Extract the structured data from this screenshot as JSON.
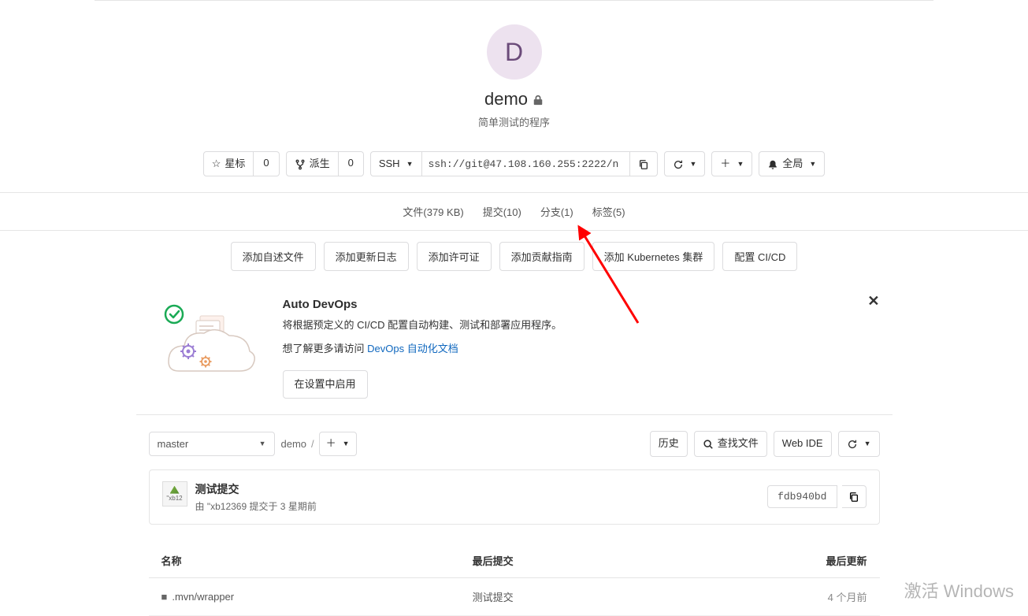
{
  "project": {
    "avatar_letter": "D",
    "name": "demo",
    "description": "简单测试的程序"
  },
  "actions": {
    "star_label": "星标",
    "star_count": "0",
    "fork_label": "派生",
    "fork_count": "0",
    "protocol": "SSH",
    "clone_url": "ssh://git@47.108.160.255:2222/n",
    "notification_label": "全局"
  },
  "stats": {
    "files": "文件(379 KB)",
    "commits": "提交(10)",
    "branches": "分支(1)",
    "tags": "标签(5)"
  },
  "suggestions": {
    "readme": "添加自述文件",
    "changelog": "添加更新日志",
    "license": "添加许可证",
    "contributing": "添加贡献指南",
    "kubernetes": "添加 Kubernetes 集群",
    "cicd": "配置 CI/CD"
  },
  "devops": {
    "title": "Auto DevOps",
    "desc": "将根据预定义的 CI/CD 配置自动构建、测试和部署应用程序。",
    "learn_prefix": "想了解更多请访问 ",
    "learn_link": "DevOps 自动化文档",
    "enable_btn": "在设置中启用"
  },
  "repo": {
    "branch": "master",
    "breadcrumb_root": "demo",
    "history_btn": "历史",
    "find_file_btn": "查找文件",
    "web_ide_btn": "Web IDE"
  },
  "commit": {
    "avatar_text": "\"xb12",
    "title": "测试提交",
    "meta": "由 \"xb12369 提交于 3 星期前",
    "sha": "fdb940bd"
  },
  "table": {
    "col_name": "名称",
    "col_commit": "最后提交",
    "col_update": "最后更新",
    "rows": [
      {
        "name": ".mvn/wrapper",
        "commit": "测试提交",
        "updated": "4 个月前"
      }
    ]
  },
  "watermark": "激活 Windows"
}
